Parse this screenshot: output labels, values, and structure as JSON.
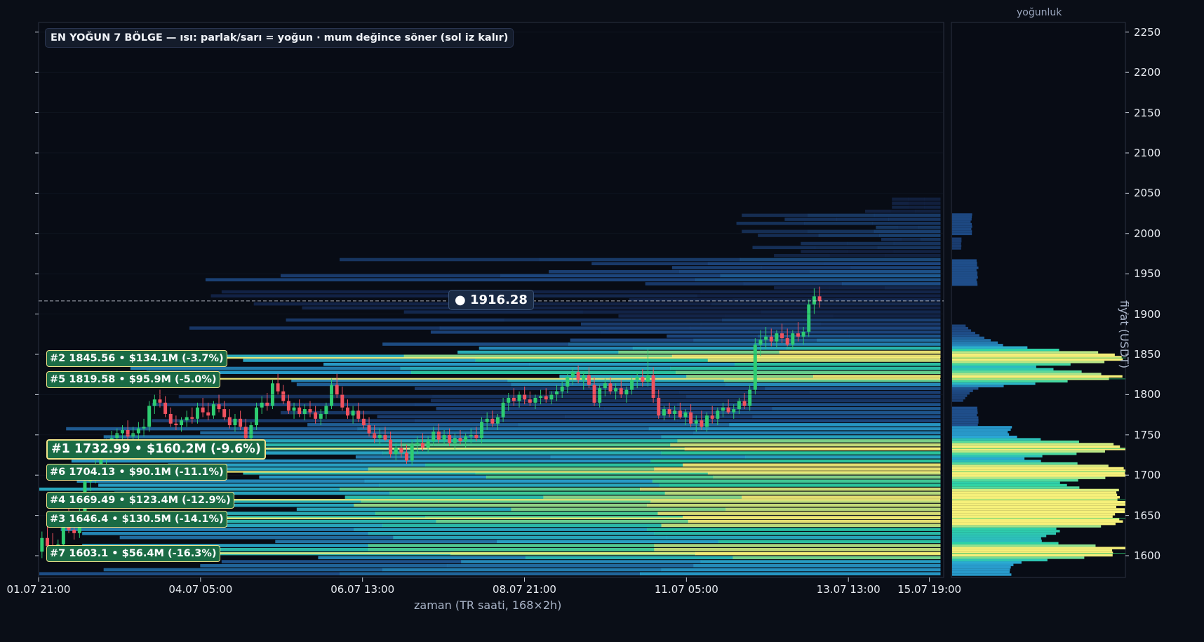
{
  "title": "EN YOĞUN 7 BÖLGE — ısı: parlak/sarı = yoğun · mum değince söner (sol iz kalır)",
  "current_price_label": "● 1916.28",
  "profile_title": "yoğunluk",
  "xlabel": "zaman (TR saati, 168×2h)",
  "ylabel": "fiyat (USDT)",
  "zones": [
    {
      "text": "#2  1845.56  •  $134.1M  (-3.7%)",
      "rank": 2,
      "price": 1845.56,
      "volume_musd": 134.1,
      "pct": -3.7
    },
    {
      "text": "#5  1819.58  •  $95.9M  (-5.0%)",
      "rank": 5,
      "price": 1819.58,
      "volume_musd": 95.9,
      "pct": -5.0
    },
    {
      "text": "#1  1732.99  •  $160.2M  (-9.6%)",
      "rank": 1,
      "price": 1732.99,
      "volume_musd": 160.2,
      "pct": -9.6
    },
    {
      "text": "#6  1704.13  •  $90.1M  (-11.1%)",
      "rank": 6,
      "price": 1704.13,
      "volume_musd": 90.1,
      "pct": -11.1
    },
    {
      "text": "#4  1669.49  •  $123.4M  (-12.9%)",
      "rank": 4,
      "price": 1669.49,
      "volume_musd": 123.4,
      "pct": -12.9
    },
    {
      "text": "#3  1646.4  •  $130.5M  (-14.1%)",
      "rank": 3,
      "price": 1646.4,
      "volume_musd": 130.5,
      "pct": -14.1
    },
    {
      "text": "#7  1603.1  •  $56.4M  (-16.3%)",
      "rank": 7,
      "price": 1603.1,
      "volume_musd": 56.4,
      "pct": -16.3
    }
  ],
  "colors": {
    "background": "#0a0e17",
    "up": "#2ecc71",
    "down": "#f0525f",
    "zone_label_bg": "#1a6b45",
    "zone_label_border": "#f3e48a",
    "heat_low": "#1f4e8a",
    "heat_mid": "#2fd4a5",
    "heat_high": "#f6f07a"
  },
  "chart_data": {
    "type": "heatmap",
    "title": "EN YOĞUN 7 BÖLGE — ısı: parlak/sarı = yoğun · mum değince söner (sol iz kalır)",
    "xlabel": "zaman (TR saati, 168×2h)",
    "ylabel": "fiyat (USDT)",
    "x_ticks": [
      "01.07 21:00",
      "04.07 05:00",
      "06.07 13:00",
      "08.07 21:00",
      "11.07 05:00",
      "13.07 13:00",
      "15.07 19:00"
    ],
    "y_ticks": [
      1600,
      1650,
      1700,
      1750,
      1800,
      1850,
      1900,
      1950,
      2000,
      2050,
      2100,
      2150,
      2200,
      2250
    ],
    "ylim": [
      1573,
      2262
    ],
    "n_candles": 168,
    "candle_interval": "2h",
    "current_price": 1916.28,
    "candles": [
      [
        1605,
        1630,
        1597,
        1622
      ],
      [
        1622,
        1640,
        1608,
        1612
      ],
      [
        1612,
        1628,
        1600,
        1606
      ],
      [
        1606,
        1620,
        1595,
        1614
      ],
      [
        1614,
        1650,
        1610,
        1642
      ],
      [
        1642,
        1660,
        1628,
        1632
      ],
      [
        1632,
        1648,
        1620,
        1628
      ],
      [
        1628,
        1660,
        1622,
        1654
      ],
      [
        1654,
        1700,
        1648,
        1692
      ],
      [
        1692,
        1712,
        1680,
        1700
      ],
      [
        1700,
        1720,
        1690,
        1712
      ],
      [
        1712,
        1730,
        1702,
        1720
      ],
      [
        1720,
        1745,
        1712,
        1738
      ],
      [
        1738,
        1755,
        1728,
        1746
      ],
      [
        1746,
        1758,
        1736,
        1752
      ],
      [
        1752,
        1762,
        1742,
        1756
      ],
      [
        1756,
        1768,
        1744,
        1748
      ],
      [
        1748,
        1760,
        1738,
        1752
      ],
      [
        1752,
        1766,
        1744,
        1758
      ],
      [
        1758,
        1770,
        1748,
        1760
      ],
      [
        1760,
        1792,
        1754,
        1786
      ],
      [
        1786,
        1800,
        1776,
        1794
      ],
      [
        1794,
        1806,
        1784,
        1790
      ],
      [
        1790,
        1798,
        1772,
        1776
      ],
      [
        1776,
        1784,
        1760,
        1764
      ],
      [
        1764,
        1774,
        1756,
        1762
      ],
      [
        1762,
        1772,
        1754,
        1768
      ],
      [
        1768,
        1780,
        1760,
        1772
      ],
      [
        1772,
        1784,
        1764,
        1770
      ],
      [
        1770,
        1790,
        1764,
        1784
      ],
      [
        1784,
        1796,
        1772,
        1778
      ],
      [
        1778,
        1790,
        1768,
        1774
      ],
      [
        1774,
        1792,
        1770,
        1788
      ],
      [
        1788,
        1800,
        1778,
        1782
      ],
      [
        1782,
        1792,
        1768,
        1772
      ],
      [
        1772,
        1782,
        1758,
        1762
      ],
      [
        1762,
        1776,
        1754,
        1770
      ],
      [
        1770,
        1780,
        1756,
        1760
      ],
      [
        1760,
        1770,
        1742,
        1746
      ],
      [
        1746,
        1766,
        1738,
        1762
      ],
      [
        1762,
        1790,
        1756,
        1784
      ],
      [
        1784,
        1798,
        1776,
        1790
      ],
      [
        1790,
        1802,
        1780,
        1786
      ],
      [
        1786,
        1818,
        1782,
        1814
      ],
      [
        1814,
        1826,
        1800,
        1804
      ],
      [
        1804,
        1812,
        1788,
        1792
      ],
      [
        1792,
        1800,
        1776,
        1780
      ],
      [
        1780,
        1790,
        1770,
        1784
      ],
      [
        1784,
        1794,
        1772,
        1776
      ],
      [
        1776,
        1788,
        1768,
        1782
      ],
      [
        1782,
        1792,
        1772,
        1778
      ],
      [
        1778,
        1786,
        1764,
        1770
      ],
      [
        1770,
        1782,
        1762,
        1776
      ],
      [
        1776,
        1790,
        1770,
        1786
      ],
      [
        1786,
        1820,
        1782,
        1812
      ],
      [
        1812,
        1826,
        1796,
        1800
      ],
      [
        1800,
        1810,
        1780,
        1784
      ],
      [
        1784,
        1794,
        1770,
        1774
      ],
      [
        1774,
        1786,
        1764,
        1780
      ],
      [
        1780,
        1790,
        1766,
        1770
      ],
      [
        1770,
        1780,
        1758,
        1762
      ],
      [
        1762,
        1772,
        1748,
        1752
      ],
      [
        1752,
        1762,
        1740,
        1746
      ],
      [
        1746,
        1758,
        1738,
        1750
      ],
      [
        1750,
        1760,
        1742,
        1744
      ],
      [
        1744,
        1754,
        1722,
        1726
      ],
      [
        1726,
        1740,
        1718,
        1734
      ],
      [
        1734,
        1744,
        1722,
        1728
      ],
      [
        1728,
        1738,
        1714,
        1718
      ],
      [
        1718,
        1744,
        1712,
        1738
      ],
      [
        1738,
        1748,
        1726,
        1740
      ],
      [
        1740,
        1752,
        1730,
        1734
      ],
      [
        1734,
        1748,
        1728,
        1742
      ],
      [
        1742,
        1760,
        1736,
        1754
      ],
      [
        1754,
        1764,
        1740,
        1744
      ],
      [
        1744,
        1756,
        1738,
        1750
      ],
      [
        1750,
        1758,
        1736,
        1740
      ],
      [
        1740,
        1752,
        1732,
        1746
      ],
      [
        1746,
        1756,
        1738,
        1742
      ],
      [
        1742,
        1752,
        1734,
        1748
      ],
      [
        1748,
        1758,
        1740,
        1750
      ],
      [
        1750,
        1760,
        1742,
        1746
      ],
      [
        1746,
        1772,
        1740,
        1766
      ],
      [
        1766,
        1778,
        1756,
        1770
      ],
      [
        1770,
        1780,
        1760,
        1764
      ],
      [
        1764,
        1776,
        1756,
        1772
      ],
      [
        1772,
        1796,
        1766,
        1790
      ],
      [
        1790,
        1802,
        1780,
        1796
      ],
      [
        1796,
        1808,
        1786,
        1792
      ],
      [
        1792,
        1804,
        1784,
        1800
      ],
      [
        1800,
        1810,
        1788,
        1794
      ],
      [
        1794,
        1804,
        1786,
        1790
      ],
      [
        1790,
        1800,
        1782,
        1796
      ],
      [
        1796,
        1806,
        1788,
        1798
      ],
      [
        1798,
        1808,
        1790,
        1794
      ],
      [
        1794,
        1804,
        1788,
        1800
      ],
      [
        1800,
        1812,
        1792,
        1804
      ],
      [
        1804,
        1816,
        1796,
        1810
      ],
      [
        1810,
        1826,
        1802,
        1822
      ],
      [
        1822,
        1834,
        1812,
        1828
      ],
      [
        1828,
        1836,
        1814,
        1818
      ],
      [
        1818,
        1828,
        1806,
        1824
      ],
      [
        1824,
        1834,
        1808,
        1812
      ],
      [
        1812,
        1822,
        1786,
        1790
      ],
      [
        1790,
        1812,
        1784,
        1808
      ],
      [
        1808,
        1820,
        1798,
        1814
      ],
      [
        1814,
        1822,
        1800,
        1804
      ],
      [
        1804,
        1814,
        1794,
        1808
      ],
      [
        1808,
        1818,
        1796,
        1800
      ],
      [
        1800,
        1810,
        1790,
        1806
      ],
      [
        1806,
        1824,
        1800,
        1818
      ],
      [
        1818,
        1828,
        1808,
        1822
      ],
      [
        1822,
        1832,
        1810,
        1816
      ],
      [
        1816,
        1856,
        1810,
        1824
      ],
      [
        1824,
        1834,
        1790,
        1796
      ],
      [
        1796,
        1806,
        1770,
        1774
      ],
      [
        1774,
        1786,
        1768,
        1782
      ],
      [
        1782,
        1790,
        1772,
        1776
      ],
      [
        1776,
        1786,
        1768,
        1780
      ],
      [
        1780,
        1790,
        1770,
        1772
      ],
      [
        1772,
        1782,
        1762,
        1778
      ],
      [
        1778,
        1788,
        1760,
        1764
      ],
      [
        1764,
        1774,
        1754,
        1768
      ],
      [
        1768,
        1780,
        1756,
        1760
      ],
      [
        1760,
        1778,
        1754,
        1774
      ],
      [
        1774,
        1786,
        1764,
        1770
      ],
      [
        1770,
        1784,
        1762,
        1780
      ],
      [
        1780,
        1790,
        1772,
        1784
      ],
      [
        1784,
        1794,
        1776,
        1778
      ],
      [
        1778,
        1788,
        1770,
        1782
      ],
      [
        1782,
        1796,
        1776,
        1792
      ],
      [
        1792,
        1802,
        1782,
        1786
      ],
      [
        1786,
        1812,
        1780,
        1806
      ],
      [
        1806,
        1870,
        1800,
        1862
      ],
      [
        1862,
        1880,
        1848,
        1868
      ],
      [
        1868,
        1884,
        1856,
        1872
      ],
      [
        1872,
        1882,
        1860,
        1866
      ],
      [
        1866,
        1880,
        1858,
        1876
      ],
      [
        1876,
        1888,
        1864,
        1870
      ],
      [
        1870,
        1882,
        1860,
        1862
      ],
      [
        1862,
        1880,
        1856,
        1876
      ],
      [
        1876,
        1890,
        1866,
        1872
      ],
      [
        1872,
        1884,
        1862,
        1878
      ],
      [
        1878,
        1918,
        1872,
        1912
      ],
      [
        1912,
        1932,
        1900,
        1922
      ],
      [
        1922,
        1934,
        1908,
        1916
      ]
    ]
  }
}
